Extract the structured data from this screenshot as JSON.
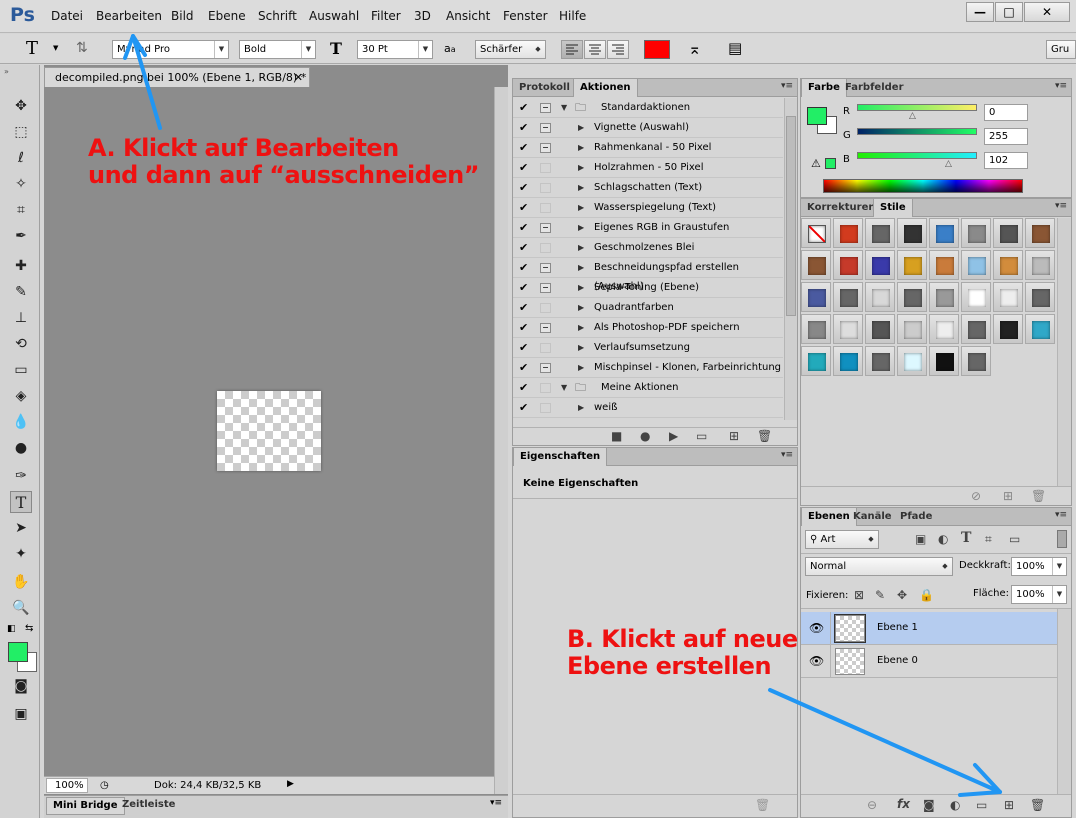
{
  "app": {
    "logo": "Ps"
  },
  "menu": [
    "Datei",
    "Bearbeiten",
    "Bild",
    "Ebene",
    "Schrift",
    "Auswahl",
    "Filter",
    "3D",
    "Ansicht",
    "Fenster",
    "Hilfe"
  ],
  "window_buttons": {
    "minimize": "—",
    "restore": "□",
    "close": "✕"
  },
  "options": {
    "tool_icon": "T",
    "font_family": "Myriad Pro",
    "font_style": "Bold",
    "font_size": "30 Pt",
    "aa_glyph": "a",
    "antialias": "Schärfer",
    "text_color": "#ff0000",
    "workspace": "Gru"
  },
  "document": {
    "tab_title": "decompiled.png bei 100% (Ebene 1, RGB/8) *",
    "tab_close": "✕",
    "zoom": "100%",
    "doc_info": "Dok: 24,4 KB/32,5 KB"
  },
  "bottom_tabs": [
    "Mini Bridge",
    "Zeitleiste"
  ],
  "actions_panel": {
    "tabs": [
      "Protokoll",
      "Aktionen"
    ],
    "rows": [
      {
        "label": "Standardaktionen",
        "type": "set",
        "box": true
      },
      {
        "label": "Vignette (Auswahl)",
        "type": "action",
        "box": true
      },
      {
        "label": "Rahmenkanal - 50 Pixel",
        "type": "action",
        "box": true
      },
      {
        "label": "Holzrahmen - 50 Pixel",
        "type": "action",
        "box": false
      },
      {
        "label": "Schlagschatten (Text)",
        "type": "action",
        "box": false
      },
      {
        "label": "Wasserspiegelung (Text)",
        "type": "action",
        "box": false
      },
      {
        "label": "Eigenes RGB in Graustufen",
        "type": "action",
        "box": true
      },
      {
        "label": "Geschmolzenes Blei",
        "type": "action",
        "box": false
      },
      {
        "label": "Beschneidungspfad erstellen (Auswahl)",
        "type": "action",
        "box": true
      },
      {
        "label": "Sepia-Toning (Ebene)",
        "type": "action",
        "box": true
      },
      {
        "label": "Quadrantfarben",
        "type": "action",
        "box": false
      },
      {
        "label": "Als Photoshop-PDF speichern",
        "type": "action",
        "box": true
      },
      {
        "label": "Verlaufsumsetzung",
        "type": "action",
        "box": false
      },
      {
        "label": "Mischpinsel - Klonen, Farbeinrichtung",
        "type": "action",
        "box": true
      },
      {
        "label": "Meine Aktionen",
        "type": "set",
        "box": false
      },
      {
        "label": "weiß",
        "type": "action",
        "box": false
      }
    ],
    "check": "✔"
  },
  "properties_panel": {
    "tab": "Eigenschaften",
    "empty_text": "Keine Eigenschaften"
  },
  "color_panel": {
    "tabs": [
      "Farbe",
      "Farbfelder"
    ],
    "fg": "#22ee66",
    "channels": [
      {
        "label": "R",
        "value": "0"
      },
      {
        "label": "G",
        "value": "255"
      },
      {
        "label": "B",
        "value": "102"
      }
    ]
  },
  "styles_panel": {
    "tabs": [
      "Korrekturen",
      "Stile"
    ]
  },
  "layers_panel": {
    "tabs": [
      "Ebenen",
      "Kanäle",
      "Pfade"
    ],
    "filter": "Art",
    "blend_mode": "Normal",
    "opacity_label": "Deckkraft:",
    "opacity": "100%",
    "lock_label": "Fixieren:",
    "fill_label": "Fläche:",
    "fill": "100%",
    "layers": [
      {
        "name": "Ebene 1",
        "selected": true
      },
      {
        "name": "Ebene 0",
        "selected": false
      }
    ]
  },
  "annotations": {
    "a_line1": "A. Klickt auf Bearbeiten",
    "a_line2": "und dann auf “ausschneiden”",
    "b_line1": "B. Klickt auf neue",
    "b_line2": "Ebene erstellen",
    "arrow_color": "#2196f3",
    "text_color": "#ee1111"
  }
}
